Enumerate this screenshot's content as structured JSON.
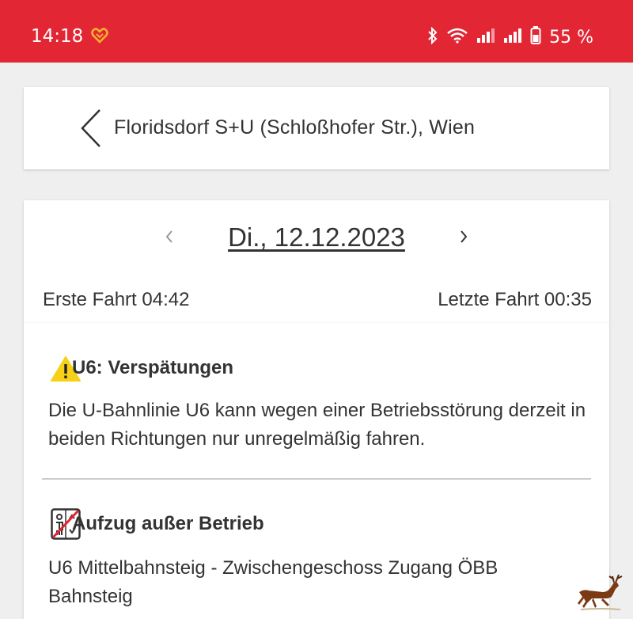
{
  "status_bar": {
    "time": "14:18",
    "battery": "55 %",
    "icons": [
      "heart-icon",
      "bluetooth-icon",
      "wifi-icon",
      "signal-icon",
      "signal-icon",
      "battery-icon"
    ],
    "background": "#e32633"
  },
  "header": {
    "back_icon": "chevron-left-icon",
    "station": "Floridsdorf S+U (Schloßhofer Str.), Wien"
  },
  "date_nav": {
    "prev_icon": "chevron-left-icon",
    "date": "Di., 12.12.2023",
    "next_icon": "chevron-right-icon",
    "first_ride": "Erste Fahrt 04:42",
    "last_ride": "Letzte Fahrt 00:35"
  },
  "notices": [
    {
      "icon": "warning-icon",
      "title": "U6: Verspätungen",
      "body": "Die U-Bahnlinie U6 kann wegen einer Betriebsstörung derzeit in beiden Richtungen nur unregelmäßig fahren."
    },
    {
      "icon": "elevator-out-of-service-icon",
      "title": "Aufzug außer Betrieb",
      "body": "U6 Mittelbahnsteig - Zwischengeschoss Zugang ÖBB Bahnsteig"
    }
  ],
  "overlay": {
    "icon": "deer-icon"
  }
}
